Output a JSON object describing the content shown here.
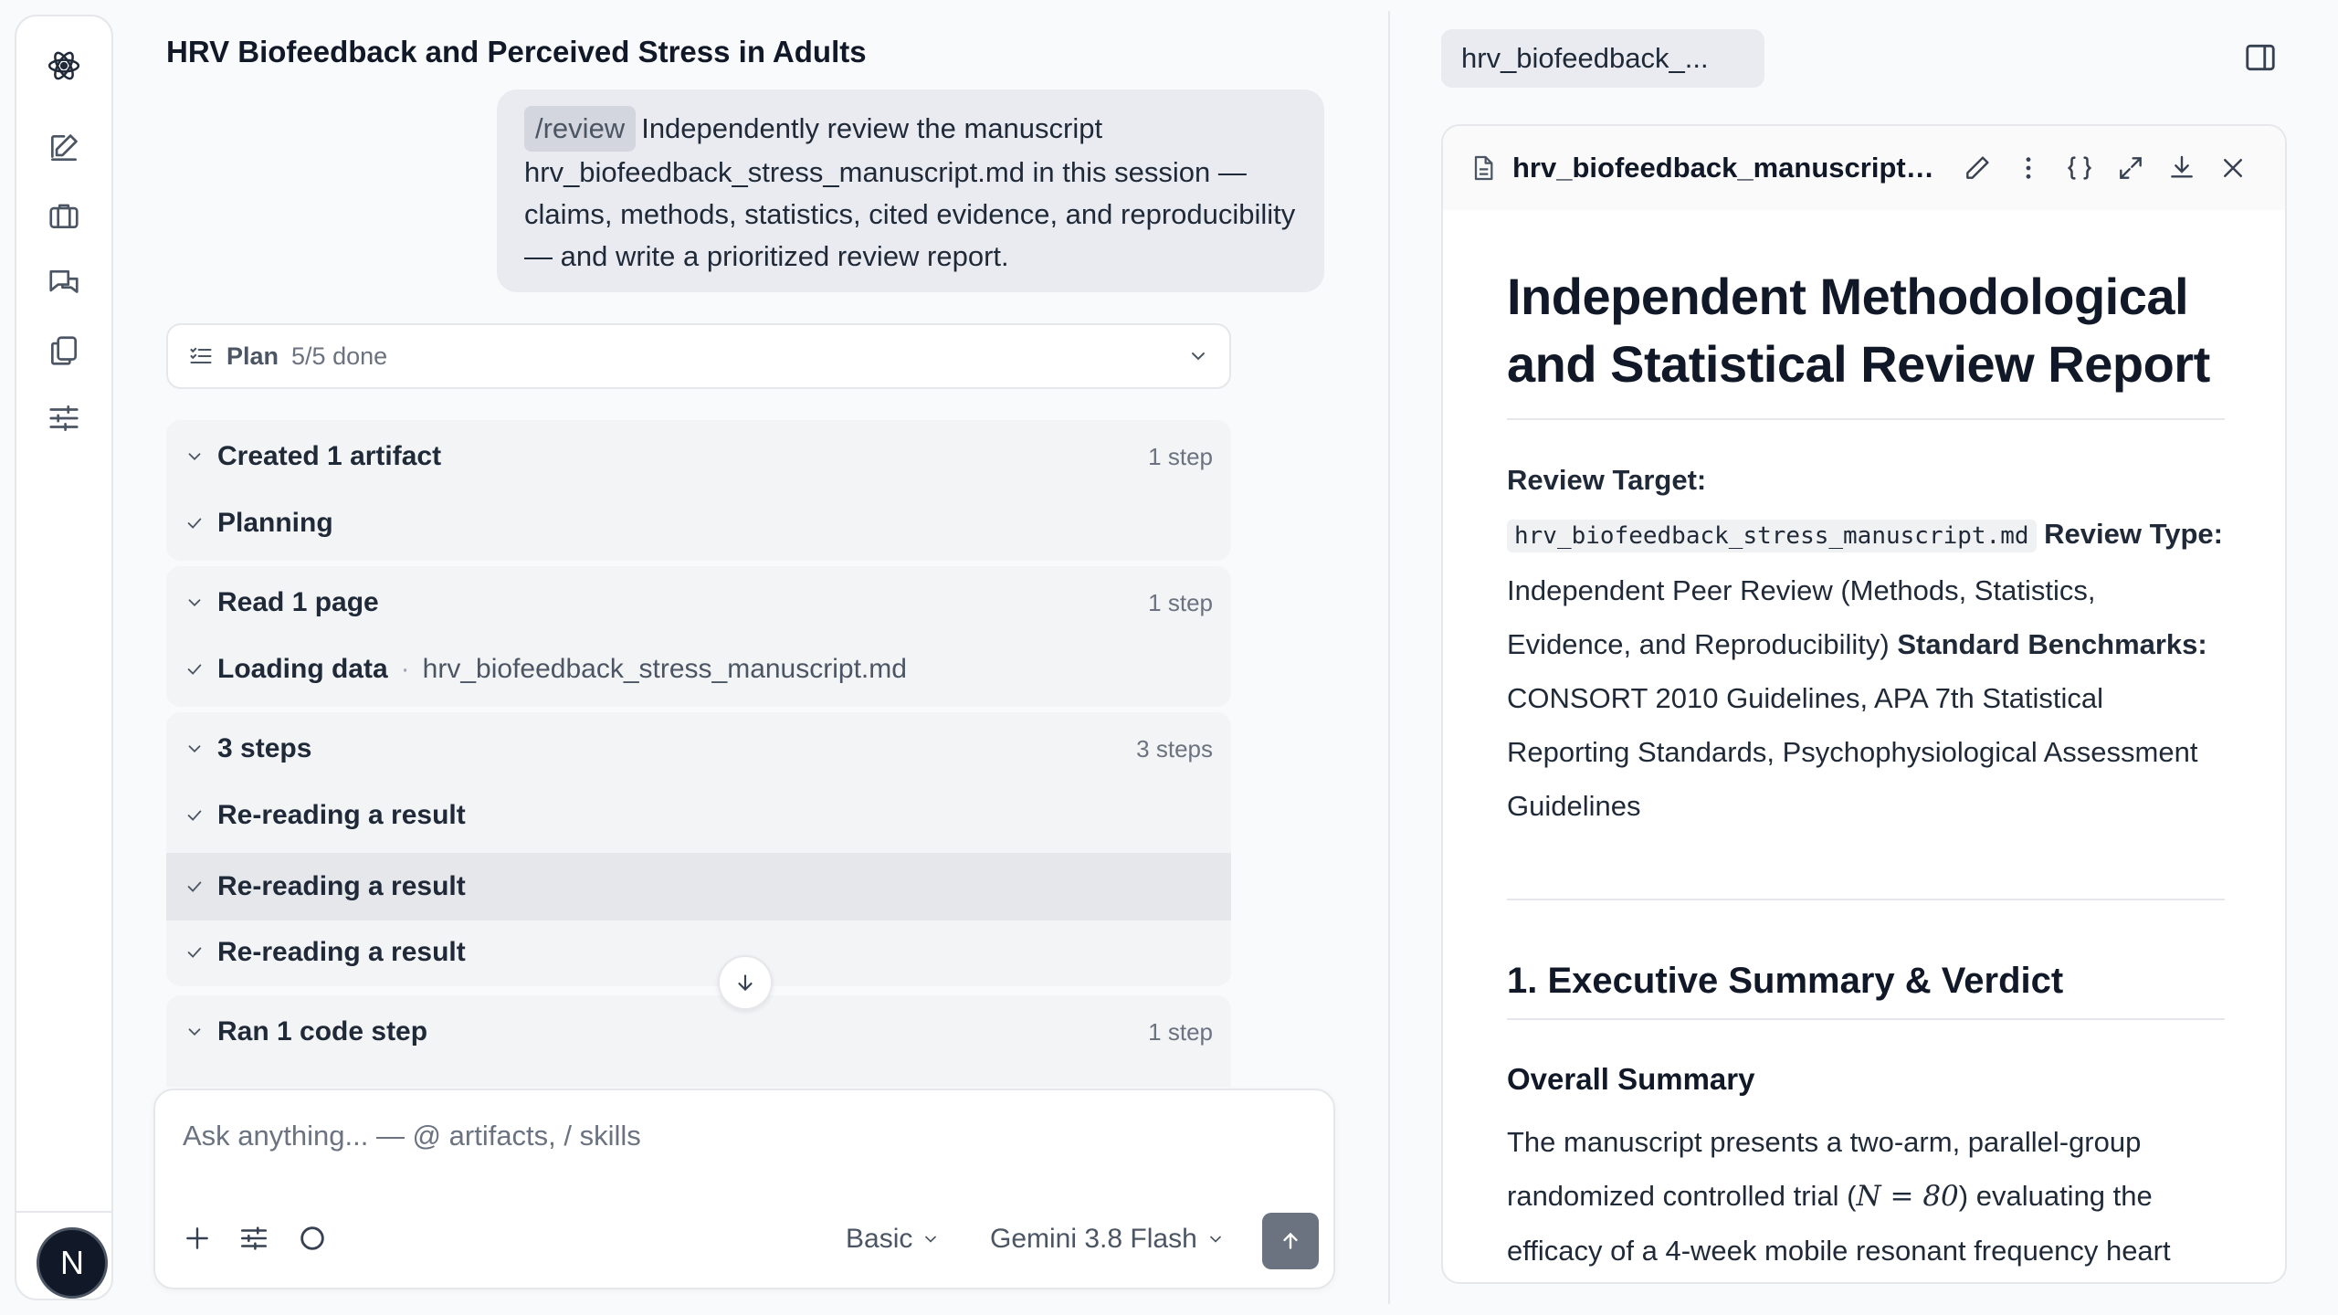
{
  "rail": {
    "items": [
      "atom-logo-icon",
      "new-chat-icon",
      "briefcase-icon",
      "chats-icon",
      "documents-icon",
      "settings-sliders-icon"
    ],
    "avatar_letter": "N"
  },
  "chat": {
    "title": "HRV Biofeedback and Perceived Stress in Adults",
    "user_message": {
      "command": "/review",
      "text": "Independently review the manuscript hrv_biofeedback_stress_manuscript.md in this session — claims, methods, statistics, cited evidence, and reproducibility — and write a prioritized review report."
    },
    "plan": {
      "label": "Plan",
      "count": "5/5 done"
    },
    "groups": [
      {
        "title": "Created 1 artifact",
        "count": "1 step",
        "steps": [
          {
            "text": "Planning"
          }
        ]
      },
      {
        "title": "Read 1 page",
        "count": "1 step",
        "steps": [
          {
            "text": "Loading data",
            "file": "hrv_biofeedback_stress_manuscript.md"
          }
        ]
      },
      {
        "title": "3 steps",
        "count": "3 steps",
        "steps": [
          {
            "text": "Re-reading a result"
          },
          {
            "text": "Re-reading a result"
          },
          {
            "text": "Re-reading a result"
          }
        ]
      },
      {
        "title": "Ran 1 code step",
        "count": "1 step",
        "steps": []
      }
    ],
    "composer": {
      "placeholder": "Ask anything... — @ artifacts, / skills",
      "mode": "Basic",
      "model": "Gemini 3.8 Flash"
    }
  },
  "artifact": {
    "tab_label": "hrv_biofeedback_...",
    "filename": "hrv_biofeedback_manuscript_review_report.md",
    "title": "Independent Methodological and Statistical Review Report",
    "meta": {
      "review_target_label": "Review Target:",
      "review_target_file": "hrv_biofeedback_stress_manuscript.md",
      "review_type_label": "Review Type:",
      "review_type": "Independent Peer Review (Methods, Statistics, Evidence, and Reproducibility)",
      "benchmarks_label": "Standard Benchmarks:",
      "benchmarks": "CONSORT 2010 Guidelines, APA 7th Statistical Reporting Standards, Psychophysiological Assessment Guidelines"
    },
    "section1_heading": "1. Executive Summary & Verdict",
    "overall_summary_heading": "Overall Summary",
    "summary_before": "The manuscript presents a two-arm, parallel-group randomized controlled trial (",
    "summary_math": "N = 80",
    "summary_after": ") evaluating the efficacy of a 4-week mobile resonant frequency heart"
  }
}
